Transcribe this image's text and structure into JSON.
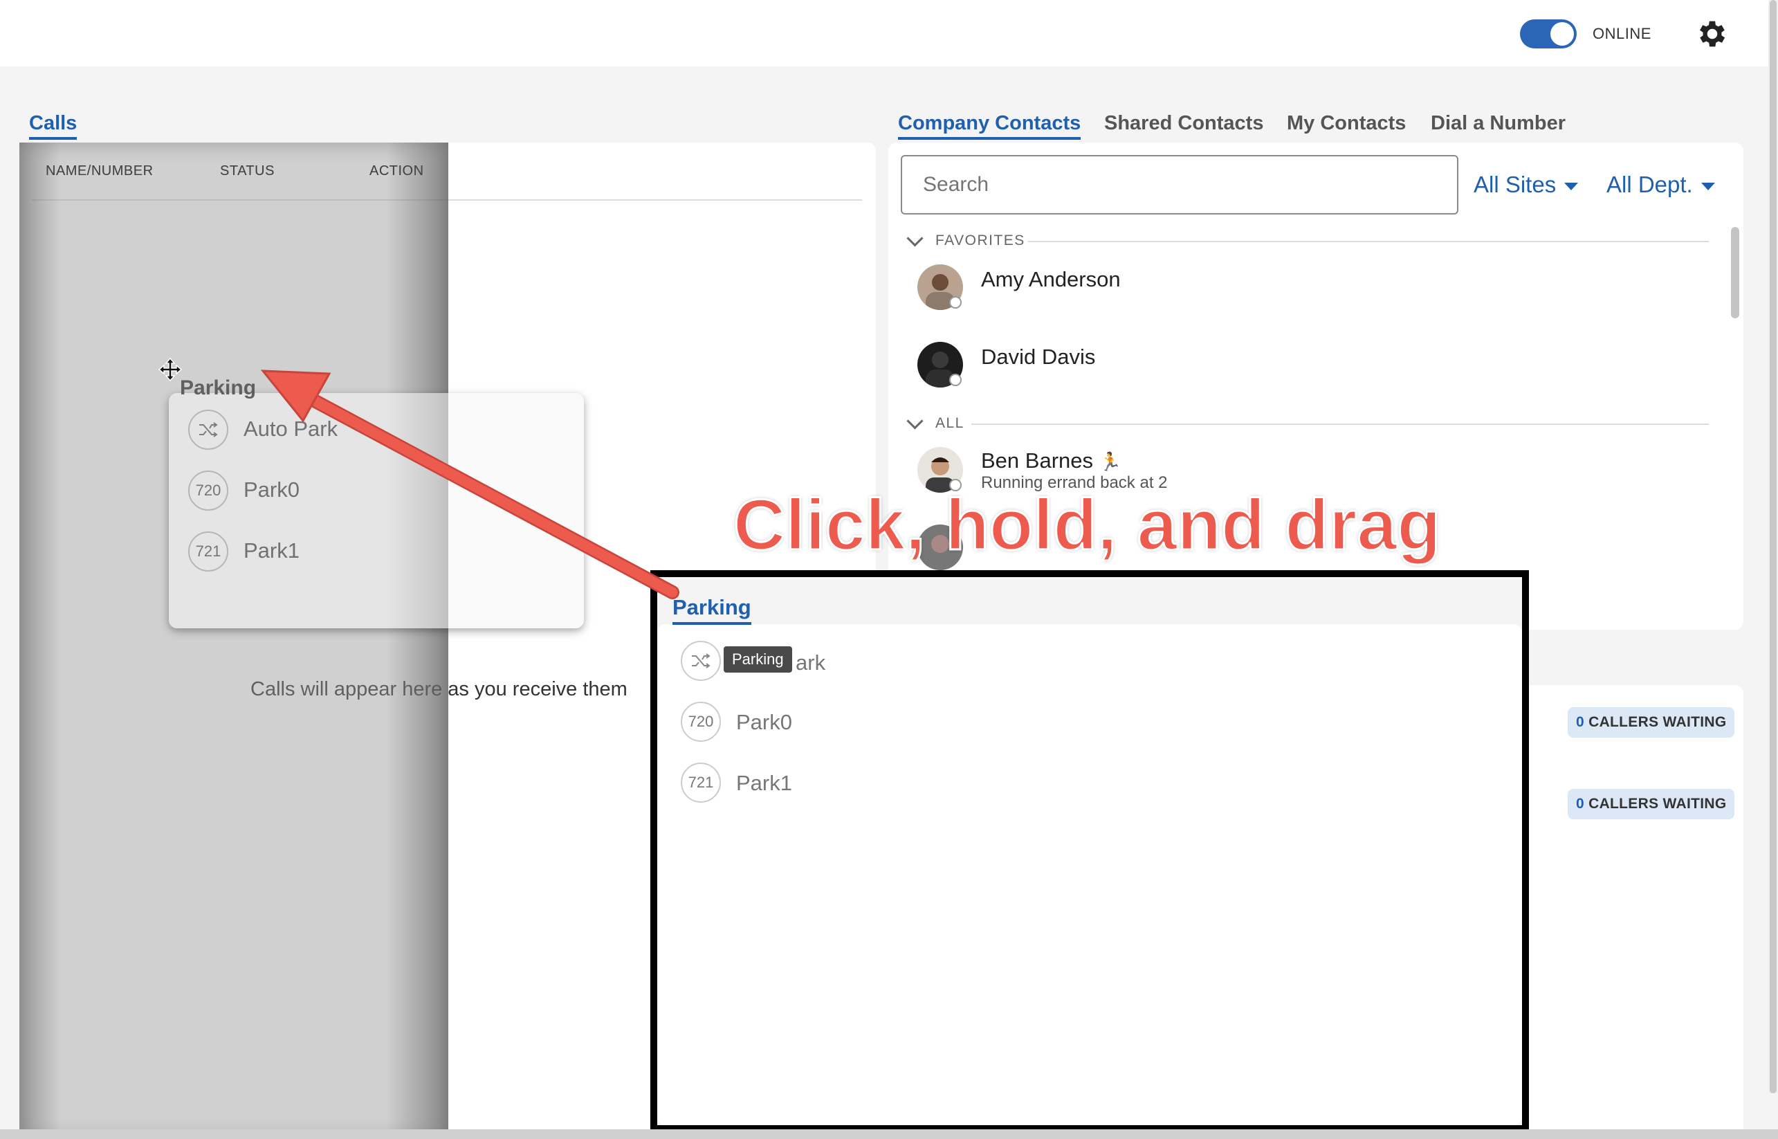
{
  "status": {
    "label": "ONLINE",
    "toggle_on": true
  },
  "left": {
    "tab": "Calls",
    "columns": [
      "NAME/NUMBER",
      "STATUS",
      "ACTION"
    ],
    "empty_message": "Calls will appear here as you receive them"
  },
  "right": {
    "tabs": [
      "Company Contacts",
      "Shared Contacts",
      "My Contacts",
      "Dial a Number"
    ],
    "search_placeholder": "Search",
    "sites_filter": "All Sites",
    "dept_filter": "All Dept.",
    "favorites_label": "FAVORITES",
    "all_label": "ALL",
    "favorites": [
      {
        "name": "Amy Anderson"
      },
      {
        "name": "David Davis"
      }
    ],
    "all": [
      {
        "name": "Ben Barnes",
        "emoji": "🏃",
        "status": "Running errand back at 2"
      }
    ],
    "queues": [
      {
        "count": "0",
        "label": "CALLERS WAITING"
      },
      {
        "count": "0",
        "label": "CALLERS WAITING"
      }
    ]
  },
  "parking": {
    "title": "Parking",
    "items": [
      {
        "badge": "shuffle-icon",
        "label": "Auto Park"
      },
      {
        "badge": "720",
        "label": "Park0"
      },
      {
        "badge": "721",
        "label": "Park1"
      }
    ],
    "tooltip": "Parking",
    "obscured_label": "ark"
  },
  "annotation": {
    "text": "Click, hold, and drag"
  },
  "colors": {
    "accent": "#1f5fb0",
    "annotation": "#ed5a4e"
  }
}
